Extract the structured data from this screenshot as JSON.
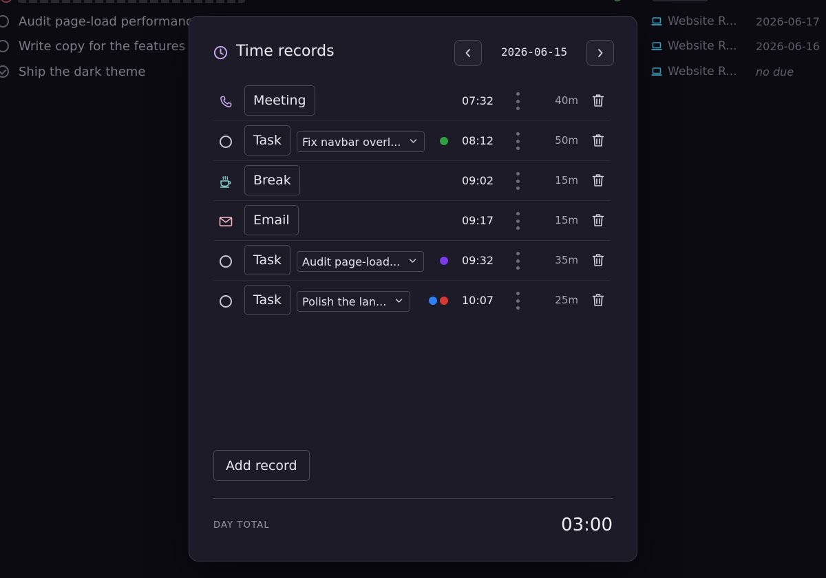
{
  "background": {
    "tasks": [
      {
        "text": "Audit page-load performanc",
        "done": false
      },
      {
        "text": "Write copy for the features",
        "done": false
      },
      {
        "text": "Ship the dark theme",
        "done": true
      }
    ],
    "projects": [
      {
        "name": "Website R...",
        "due": "2026-06-17"
      },
      {
        "name": "Website R...",
        "due": "2026-06-16"
      },
      {
        "name": "Website R...",
        "due": "no due"
      }
    ]
  },
  "header": {
    "title": "Time records",
    "date": "2026-06-15"
  },
  "records": [
    {
      "type": "Meeting",
      "icon": "phone-icon",
      "task": "",
      "dots": [],
      "time": "07:32",
      "duration": "40m"
    },
    {
      "type": "Task",
      "icon": "task-circle-icon",
      "task": "Fix navbar overl...",
      "dots": [
        "#2ea043"
      ],
      "time": "08:12",
      "duration": "50m"
    },
    {
      "type": "Break",
      "icon": "coffee-cup-icon",
      "task": "",
      "dots": [],
      "time": "09:02",
      "duration": "15m"
    },
    {
      "type": "Email",
      "icon": "mail-icon",
      "task": "",
      "dots": [],
      "time": "09:17",
      "duration": "15m"
    },
    {
      "type": "Task",
      "icon": "task-circle-icon",
      "task": "Audit page-load...",
      "dots": [
        "#7c3aed"
      ],
      "time": "09:32",
      "duration": "35m"
    },
    {
      "type": "Task",
      "icon": "task-circle-icon",
      "task": "Polish the lan...",
      "dots": [
        "#2f81f7",
        "#d73a35"
      ],
      "time": "10:07",
      "duration": "25m"
    }
  ],
  "actions": {
    "add_record": "Add record"
  },
  "footer": {
    "label": "DAY TOTAL",
    "total": "03:00"
  },
  "colors": {
    "modal_bg": "#1d1b27",
    "accent_icon": "#c7a6f0",
    "break_icon": "#7fd6c9",
    "mail_icon": "#f3b7c3",
    "project_icon": "#3aa6c4"
  }
}
